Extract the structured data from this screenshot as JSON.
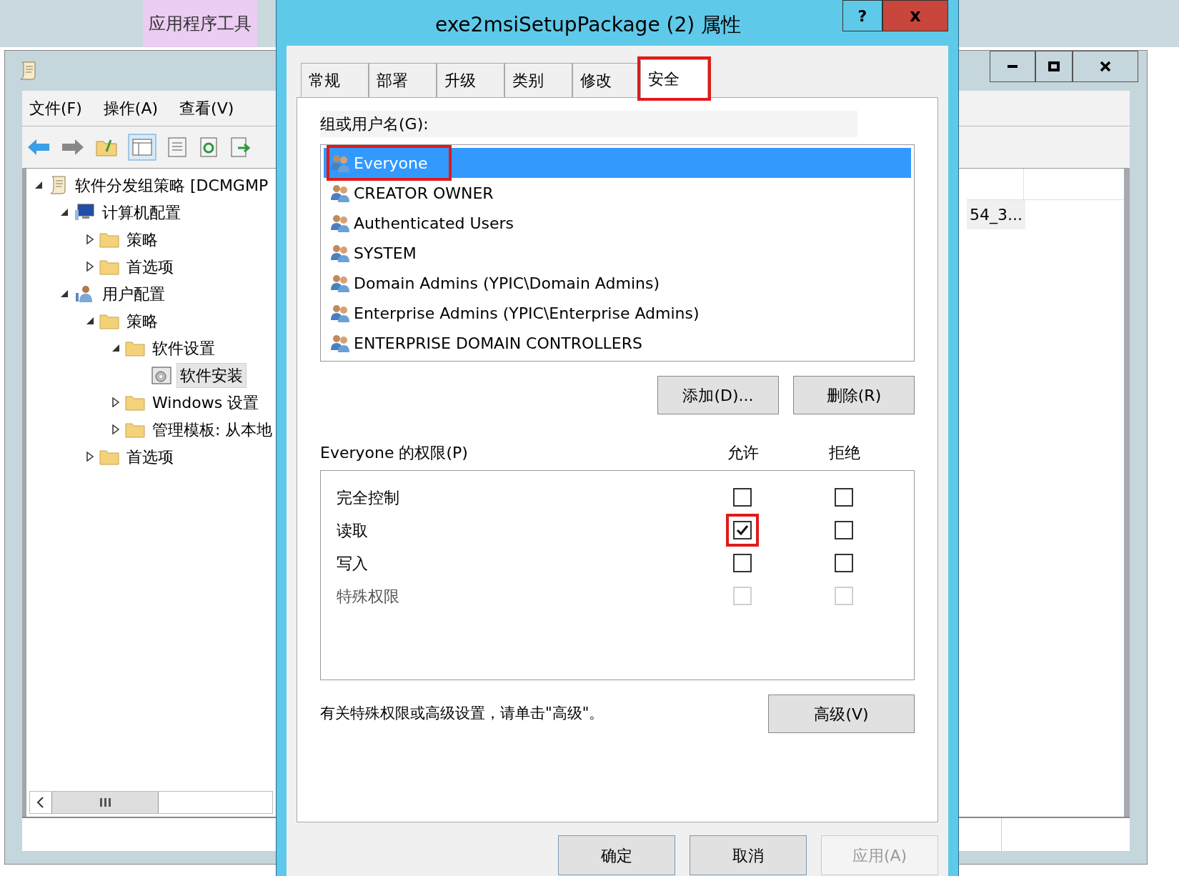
{
  "desktop": {
    "ribbon_tab": "应用程序工具"
  },
  "back_window": {
    "menu": [
      "文件(F)",
      "操作(A)",
      "查看(V)"
    ],
    "tree": [
      {
        "label": "软件分发组策略 [DCMGMP",
        "kind": "policy",
        "expanded": true,
        "selected": false,
        "children": [
          {
            "label": "计算机配置",
            "kind": "computer",
            "expanded": true,
            "selected": false,
            "children": [
              {
                "label": "策略",
                "kind": "folder",
                "expanded": false,
                "selected": false
              },
              {
                "label": "首选项",
                "kind": "folder",
                "expanded": false,
                "selected": false
              }
            ]
          },
          {
            "label": "用户配置",
            "kind": "user",
            "expanded": true,
            "selected": false,
            "children": [
              {
                "label": "策略",
                "kind": "folder",
                "expanded": true,
                "selected": false,
                "children": [
                  {
                    "label": "软件设置",
                    "kind": "folder",
                    "expanded": true,
                    "selected": false,
                    "children": [
                      {
                        "label": "软件安装",
                        "kind": "install",
                        "selected": true
                      }
                    ]
                  },
                  {
                    "label": "Windows 设置",
                    "kind": "folder",
                    "expanded": false,
                    "selected": false
                  },
                  {
                    "label": "管理模板: 从本地",
                    "kind": "folder",
                    "expanded": false,
                    "selected": false
                  }
                ]
              },
              {
                "label": "首选项",
                "kind": "folder",
                "expanded": false,
                "selected": false
              }
            ]
          }
        ]
      }
    ],
    "list_item": "54_3..."
  },
  "dialog": {
    "title": "exe2msiSetupPackage (2) 属性",
    "help": "?",
    "close": "x",
    "tabs": [
      {
        "label": "常规",
        "selected": false,
        "annotated": false
      },
      {
        "label": "部署",
        "selected": false,
        "annotated": false
      },
      {
        "label": "升级",
        "selected": false,
        "annotated": false
      },
      {
        "label": "类别",
        "selected": false,
        "annotated": false
      },
      {
        "label": "修改",
        "selected": false,
        "annotated": false
      },
      {
        "label": "安全",
        "selected": true,
        "annotated": true
      }
    ],
    "principals_label": "组或用户名(G):",
    "principals": [
      {
        "name": "Everyone",
        "selected": true,
        "annotated": true
      },
      {
        "name": "CREATOR OWNER",
        "selected": false,
        "annotated": false
      },
      {
        "name": "Authenticated Users",
        "selected": false,
        "annotated": false
      },
      {
        "name": "SYSTEM",
        "selected": false,
        "annotated": false
      },
      {
        "name": "Domain Admins (YPIC\\Domain Admins)",
        "selected": false,
        "annotated": false
      },
      {
        "name": "Enterprise Admins (YPIC\\Enterprise Admins)",
        "selected": false,
        "annotated": false
      },
      {
        "name": "ENTERPRISE DOMAIN CONTROLLERS",
        "selected": false,
        "annotated": false
      }
    ],
    "add_button": "添加(D)...",
    "remove_button": "删除(R)",
    "permissions_label": "Everyone 的权限(P)",
    "allow_header": "允许",
    "deny_header": "拒绝",
    "permissions": [
      {
        "name": "完全控制",
        "allow": false,
        "deny": false,
        "disabled": false,
        "allow_annotated": false
      },
      {
        "name": "读取",
        "allow": true,
        "deny": false,
        "disabled": false,
        "allow_annotated": true
      },
      {
        "name": "写入",
        "allow": false,
        "deny": false,
        "disabled": false,
        "allow_annotated": false
      },
      {
        "name": "特殊权限",
        "allow": false,
        "deny": false,
        "disabled": true,
        "allow_annotated": false
      }
    ],
    "advanced_hint": "有关特殊权限或高级设置，请单击\"高级\"。",
    "advanced_button": "高级(V)",
    "buttons": [
      {
        "label": "确定",
        "disabled": false
      },
      {
        "label": "取消",
        "disabled": false
      },
      {
        "label": "应用(A)",
        "disabled": true
      }
    ]
  }
}
